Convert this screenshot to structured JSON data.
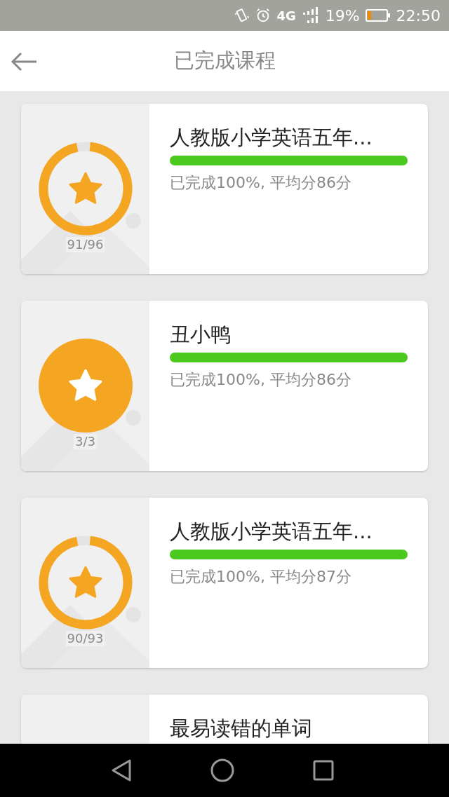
{
  "status_bar": {
    "network": "4G",
    "battery": "19%",
    "time": "22:50"
  },
  "header": {
    "title": "已完成课程"
  },
  "courses": [
    {
      "title": "人教版小学英语五年...",
      "count": "91/96",
      "kind": "ring",
      "progress": {
        "level": 1
      },
      "summary": "已完成100%, 平均分86分"
    },
    {
      "title": "丑小鸭",
      "count": "3/3",
      "kind": "full",
      "progress": {
        "level": 1
      },
      "summary": "已完成100%, 平均分86分"
    },
    {
      "title": "人教版小学英语五年...",
      "count": "90/93",
      "kind": "ring",
      "progress": {
        "level": 1
      },
      "summary": "已完成100%, 平均分87分"
    },
    {
      "title": "最易读错的单词"
    }
  ]
}
